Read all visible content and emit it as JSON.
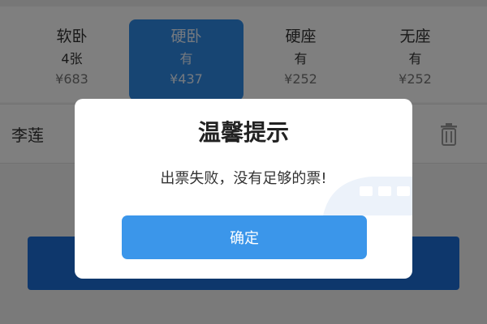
{
  "seats": [
    {
      "name": "软卧",
      "count": "4张",
      "price": "¥683",
      "selected": false
    },
    {
      "name": "硬卧",
      "count": "有",
      "price": "¥437",
      "selected": true
    },
    {
      "name": "硬座",
      "count": "有",
      "price": "¥252",
      "selected": false
    },
    {
      "name": "无座",
      "count": "有",
      "price": "¥252",
      "selected": false
    }
  ],
  "passenger": {
    "name": "李莲",
    "delete_icon": "trash-icon"
  },
  "dialog": {
    "title": "温馨提示",
    "message": "出票失败，没有足够的票!",
    "confirm_label": "确定"
  },
  "colors": {
    "accent": "#3b96ea",
    "selected_seat": "#2f8ae6",
    "submit_button": "#1d6fd8"
  }
}
